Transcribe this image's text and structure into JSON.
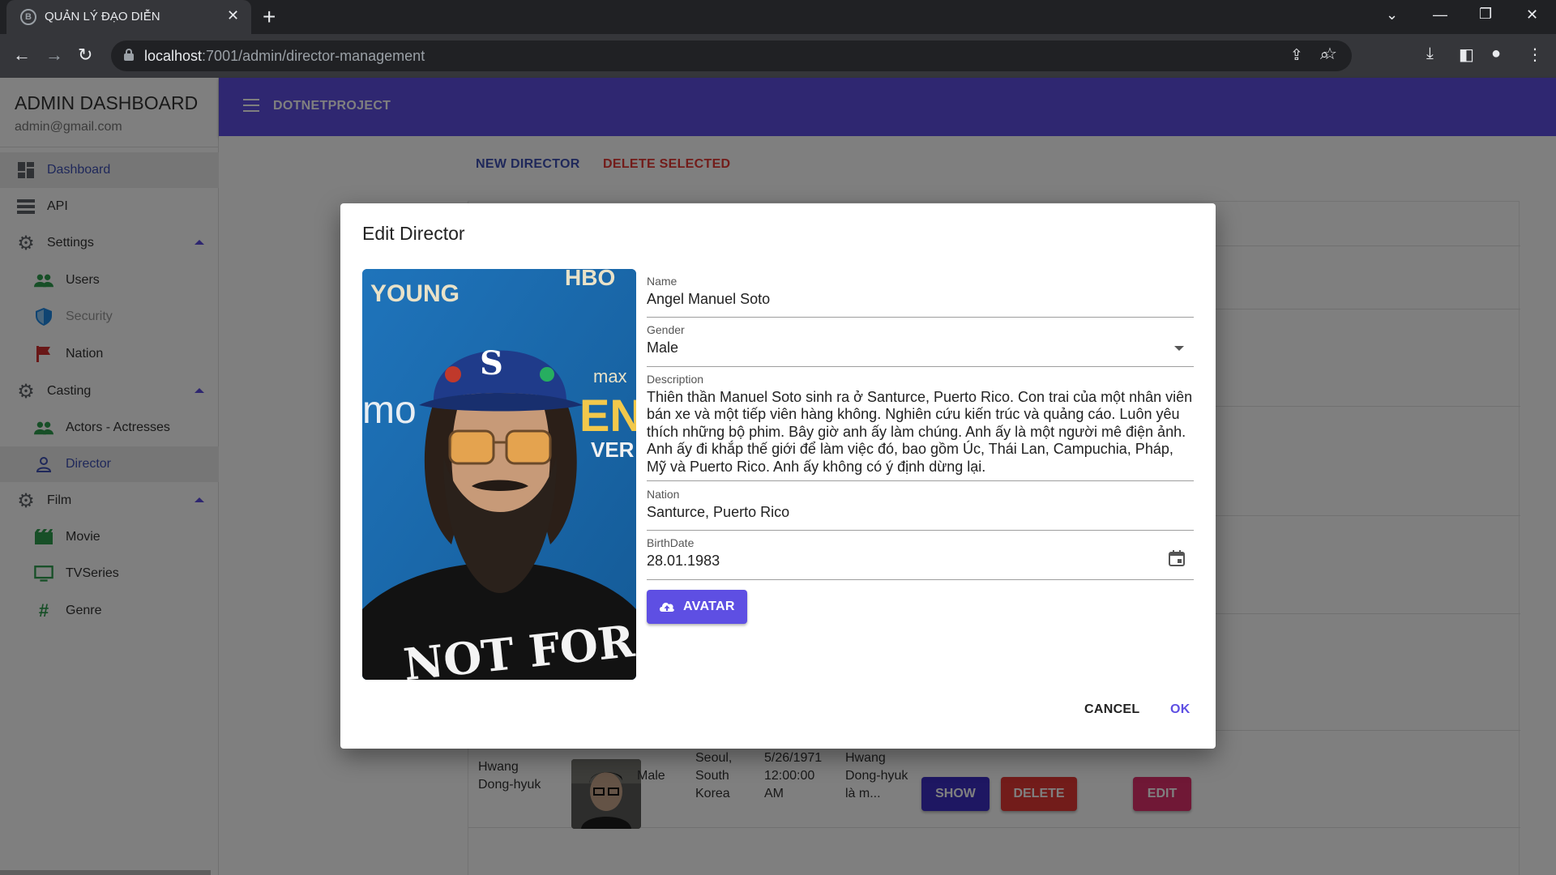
{
  "browser": {
    "tab_title": "QUẢN LÝ ĐẠO DIỄN",
    "favicon_letter": "B",
    "url_host": "localhost",
    "url_path": ":7001/admin/director-management"
  },
  "sidebar": {
    "title": "ADMIN DASHBOARD",
    "email": "admin@gmail.com",
    "items": [
      {
        "label": "Dashboard"
      },
      {
        "label": "API"
      },
      {
        "label": "Settings"
      },
      {
        "label": "Users"
      },
      {
        "label": "Security"
      },
      {
        "label": "Nation"
      },
      {
        "label": "Casting"
      },
      {
        "label": "Actors - Actresses"
      },
      {
        "label": "Director"
      },
      {
        "label": "Film"
      },
      {
        "label": "Movie"
      },
      {
        "label": "TVSeries"
      },
      {
        "label": "Genre"
      }
    ]
  },
  "appbar": {
    "brand": "DOTNETPROJECT"
  },
  "toolbar": {
    "new_label": "NEW DIRECTOR",
    "delete_selected_label": "DELETE SELECTED"
  },
  "table": {
    "edit_label": "EDIT",
    "show_label": "SHOW",
    "delete_label": "DELETE",
    "last_row": {
      "name_1": "Hwang",
      "name_2": "Dong-hyuk",
      "gender": "Male",
      "nation_1": "Seoul,",
      "nation_2": "South",
      "nation_3": "Korea",
      "birth_1": "5/26/1971",
      "birth_2": "12:00:00",
      "birth_3": "AM",
      "desc_1": "Hwang",
      "desc_2": "Dong-hyuk",
      "desc_3": "là m..."
    }
  },
  "dialog": {
    "title": "Edit Director",
    "name_label": "Name",
    "name_value": "Angel Manuel Soto",
    "gender_label": "Gender",
    "gender_value": "Male",
    "description_label": "Description",
    "description_value": "Thiên thần Manuel Soto sinh ra ở Santurce, Puerto Rico. Con trai của một nhân viên bán xe và một tiếp viên hàng không. Nghiên cứu kiến trúc và quảng cáo. Luôn yêu thích những bộ phim. Bây giờ anh ấy làm chúng. Anh ấy là một người mê điện ảnh. Anh ấy đi khắp thế giới để làm việc đó, bao gồm Úc, Thái Lan, Campuchia, Pháp, Mỹ và Puerto Rico. Anh ấy không có ý định dừng lại.",
    "nation_label": "Nation",
    "nation_value": "Santurce, Puerto Rico",
    "birthdate_label": "BirthDate",
    "birthdate_value": "28.01.1983",
    "avatar_button": "AVATAR",
    "cancel_button": "CANCEL",
    "ok_button": "OK",
    "photo_text": {
      "backdrop_1": "YOUNG",
      "backdrop_2": "HBO",
      "backdrop_3": "max",
      "backdrop_4": "ENU",
      "backdrop_5": "VER",
      "backdrop_6": "mo",
      "shirt": "NOT FOR SALE"
    }
  },
  "colors": {
    "primary": "#5e4fe3",
    "edit": "#e0306c",
    "delete": "#e53935",
    "show": "#3d2fc4",
    "link_blue": "#3f51b5"
  }
}
